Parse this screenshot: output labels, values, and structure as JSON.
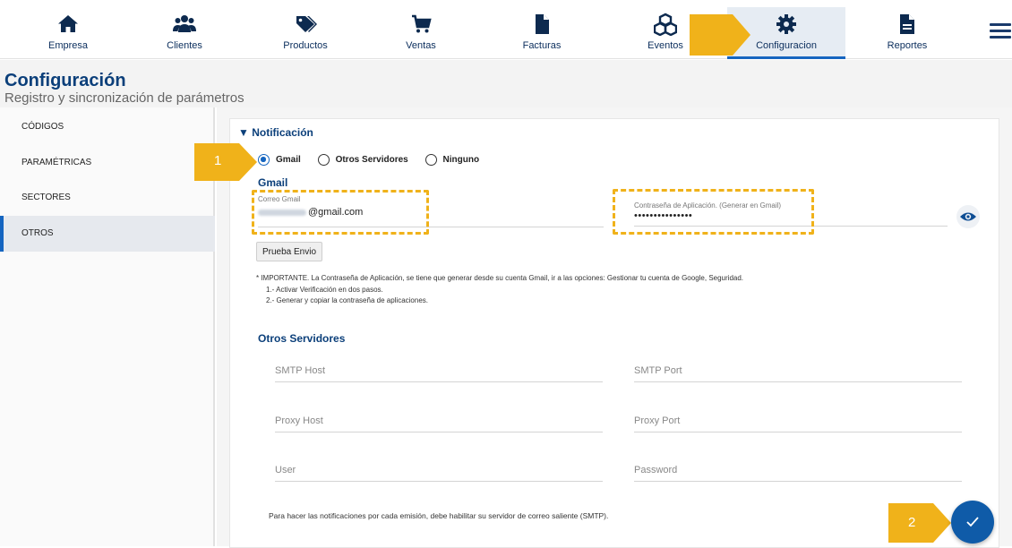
{
  "nav": {
    "items": [
      {
        "label": "Empresa",
        "icon": "home-icon"
      },
      {
        "label": "Clientes",
        "icon": "users-icon"
      },
      {
        "label": "Productos",
        "icon": "tag-icon"
      },
      {
        "label": "Ventas",
        "icon": "cart-icon"
      },
      {
        "label": "Facturas",
        "icon": "file-icon"
      },
      {
        "label": "Eventos",
        "icon": "boxes-icon"
      },
      {
        "label": "Configuracion",
        "icon": "gear-icon"
      },
      {
        "label": "Reportes",
        "icon": "report-icon"
      }
    ],
    "active": "Configuracion",
    "menu_icon": "hamburger-icon"
  },
  "header": {
    "title": "Configuración",
    "subtitle": "Registro y sincronización de parámetros"
  },
  "sidebar": {
    "items": [
      {
        "label": "CÓDIGOS"
      },
      {
        "label": "PARAMÉTRICAS"
      },
      {
        "label": "SECTORES"
      },
      {
        "label": "OTROS"
      }
    ],
    "active": "OTROS"
  },
  "notificacion": {
    "section_label": "▼ Notificación",
    "options": [
      "Gmail",
      "Otros Servidores",
      "Ninguno"
    ],
    "selected": "Gmail",
    "gmail": {
      "title": "Gmail",
      "correo_label": "Correo Gmail",
      "correo_suffix": "@gmail.com",
      "password_label": "Contraseña de Aplicación. (Generar en Gmail)",
      "password_value": "•••••••••••••••",
      "test_button": "Prueba Envio"
    },
    "important_note": "* IMPORTANTE. La Contraseña de Aplicación, se tiene que generar desde su cuenta Gmail, ir a las opciones: Gestionar tu cuenta de Google, Seguridad.",
    "steps": [
      "1.- Activar Verificación en dos pasos.",
      "2.- Generar y copiar la contraseña de aplicaciones."
    ],
    "otros": {
      "title": "Otros Servidores",
      "smtp_host": "SMTP Host",
      "smtp_port": "SMTP Port",
      "proxy_host": "Proxy Host",
      "proxy_port": "Proxy Port",
      "user": "User",
      "password": "Password"
    },
    "footer_note": "Para hacer las notificaciones por cada emisión, debe habilitar su servidor de correo saliente (SMTP)."
  },
  "callouts": [
    "1",
    "2"
  ],
  "colors": {
    "accent": "#1565c0",
    "title": "#0b3f7a",
    "callout": "#f0b21a"
  }
}
